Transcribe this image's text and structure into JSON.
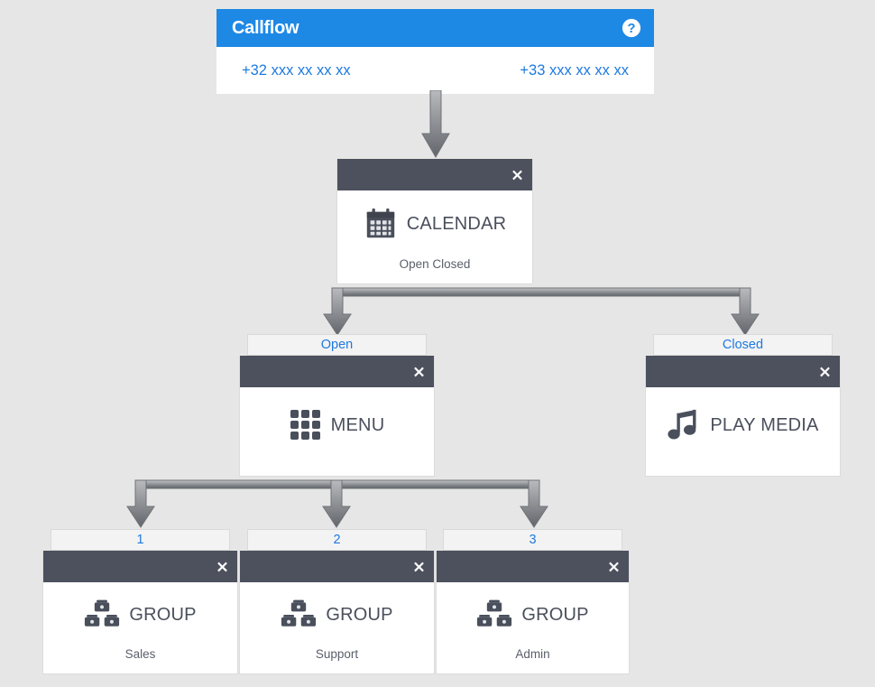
{
  "theme": {
    "background": "#e6e6e6",
    "header_blue": "#1e88e5",
    "node_header_gray": "#4d515e",
    "link_blue": "#1e7ae0",
    "node_text": "#4a4f5c",
    "arrow_gray": "#6f7277",
    "chip_bg": "#f3f3f3"
  },
  "root": {
    "title": "Callflow",
    "help_icon": "question-circle-icon",
    "numbers": [
      "+32 xxx xx xx xx",
      "+33 xxx xx xx xx"
    ]
  },
  "nodes": {
    "calendar": {
      "icon": "calendar-icon",
      "label": "CALENDAR",
      "footer": "Open Closed",
      "close_icon": "close-icon"
    },
    "menu": {
      "icon": "keypad-grid-icon",
      "label": "MENU",
      "footer": "",
      "close_icon": "close-icon"
    },
    "play_media": {
      "icon": "music-note-icon",
      "label": "PLAY MEDIA",
      "footer": "",
      "close_icon": "close-icon"
    },
    "group_sales": {
      "icon": "phone-group-icon",
      "label": "GROUP",
      "footer": "Sales",
      "close_icon": "close-icon"
    },
    "group_support": {
      "icon": "phone-group-icon",
      "label": "GROUP",
      "footer": "Support",
      "close_icon": "close-icon"
    },
    "group_admin": {
      "icon": "phone-group-icon",
      "label": "GROUP",
      "footer": "Admin",
      "close_icon": "close-icon"
    }
  },
  "branches": {
    "calendar": [
      {
        "label": "Open"
      },
      {
        "label": "Closed"
      }
    ],
    "menu": [
      {
        "label": "1"
      },
      {
        "label": "2"
      },
      {
        "label": "3"
      }
    ]
  }
}
